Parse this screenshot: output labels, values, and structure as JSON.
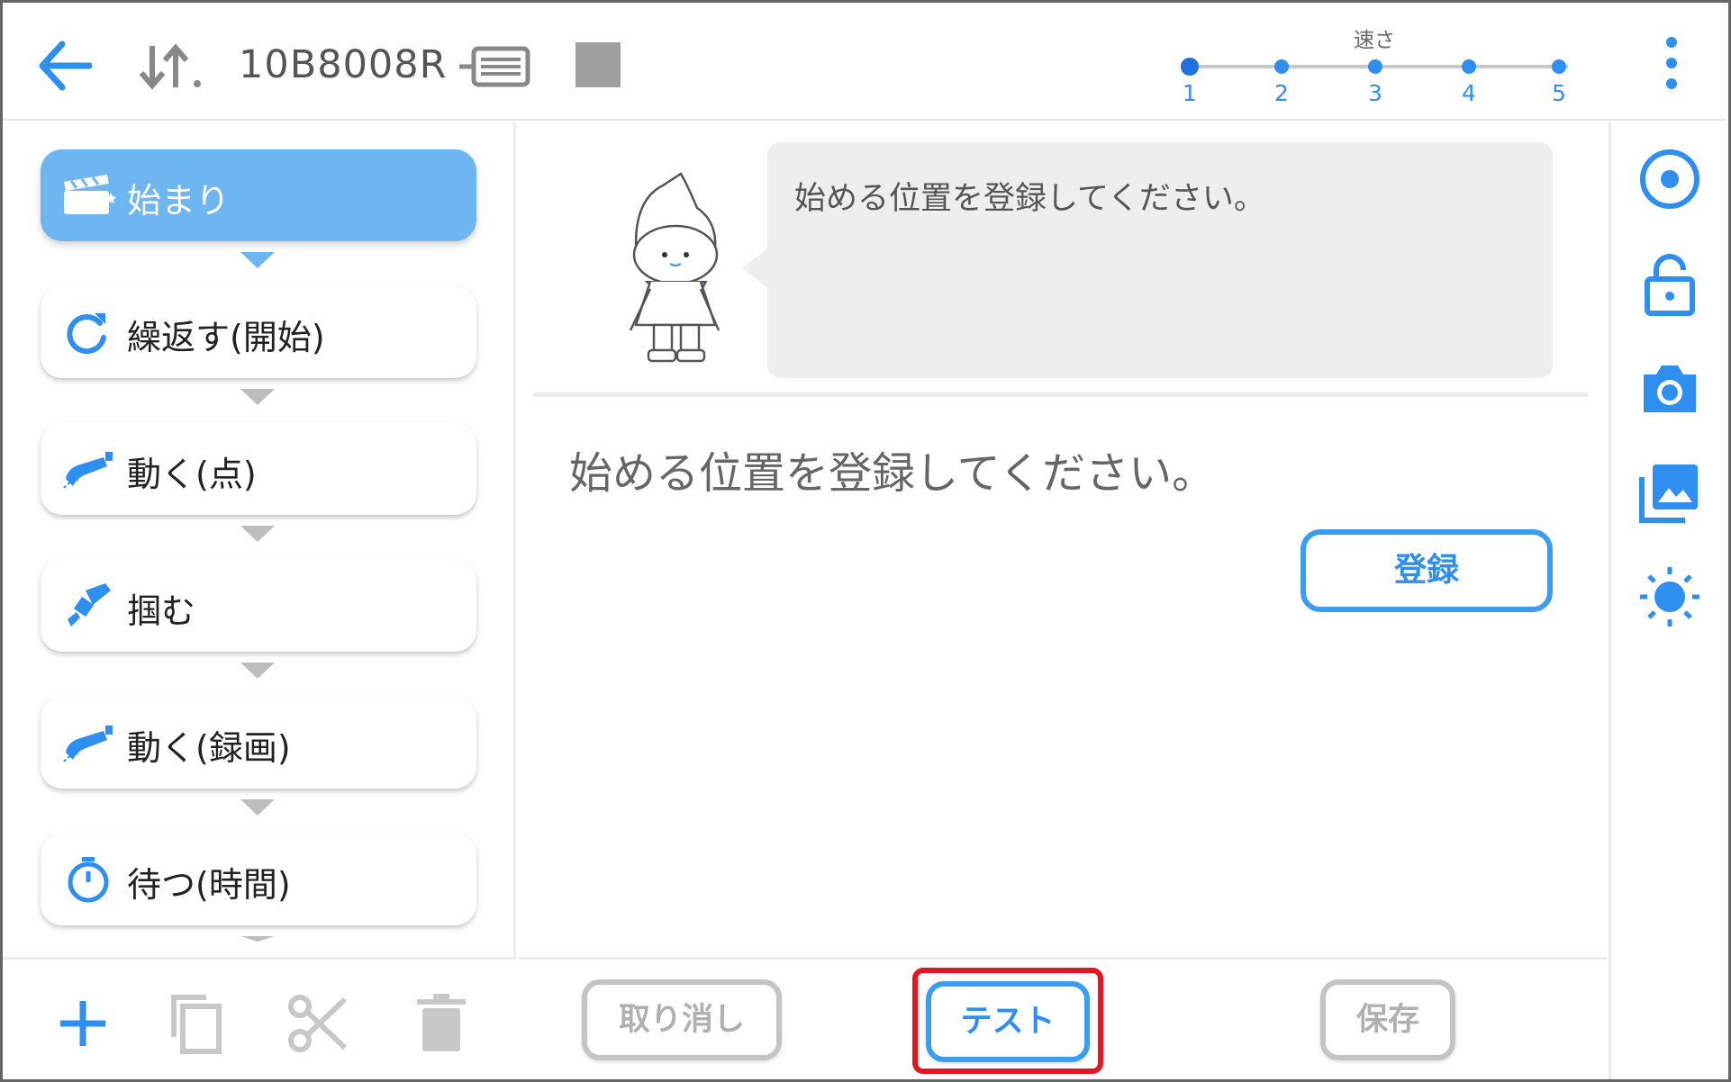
{
  "header": {
    "device_id": "10B8008R",
    "speed_label": "速さ",
    "speed_levels": [
      "1",
      "2",
      "3",
      "4",
      "5"
    ],
    "speed_selected": 1
  },
  "steps": [
    {
      "label": "始まり",
      "icon": "clapperboard-icon",
      "active": true
    },
    {
      "label": "繰返す(開始)",
      "icon": "repeat-icon",
      "active": false
    },
    {
      "label": "動く(点)",
      "icon": "robot-arm-move-icon",
      "active": false
    },
    {
      "label": "掴む",
      "icon": "gripper-icon",
      "active": false
    },
    {
      "label": "動く(録画)",
      "icon": "robot-arm-record-icon",
      "active": false
    },
    {
      "label": "待つ(時間)",
      "icon": "stopwatch-icon",
      "active": false
    }
  ],
  "main": {
    "bubble_text": "始める位置を登録してください。",
    "instruction": "始める位置を登録してください。",
    "register_button": "登録"
  },
  "footer": {
    "cancel_button": "取り消し",
    "test_button": "テスト",
    "save_button": "保存"
  },
  "colors": {
    "accent": "#2e8ff0",
    "active_step": "#6eb6f2",
    "disabled": "#b0b0b0",
    "highlight": "#e8141e"
  }
}
